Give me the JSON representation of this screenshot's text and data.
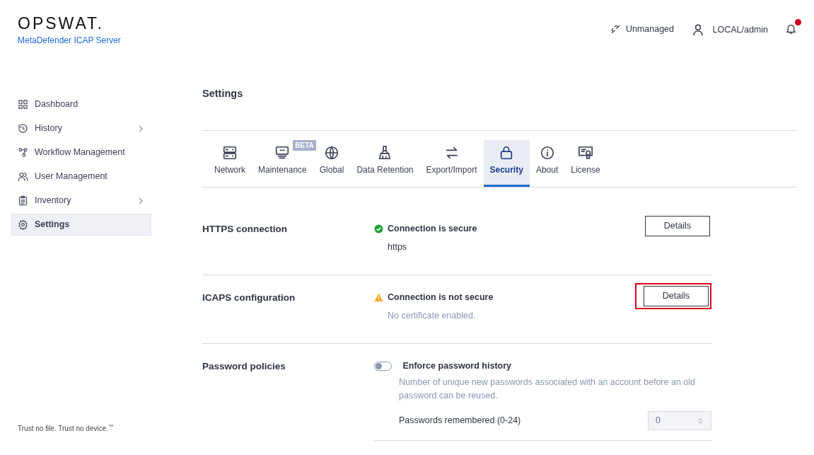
{
  "brand": {
    "logo": "OPSWAT.",
    "product": "MetaDefender ICAP Server"
  },
  "header": {
    "management": "Unmanaged",
    "user": "LOCAL/admin",
    "notification": true
  },
  "sidebar": {
    "items": [
      {
        "label": "Dashboard",
        "selected": false,
        "expandable": false
      },
      {
        "label": "History",
        "selected": false,
        "expandable": true
      },
      {
        "label": "Workflow Management",
        "selected": false,
        "expandable": false
      },
      {
        "label": "User Management",
        "selected": false,
        "expandable": false
      },
      {
        "label": "Inventory",
        "selected": false,
        "expandable": true
      },
      {
        "label": "Settings",
        "selected": true,
        "expandable": false
      }
    ],
    "footer": "Trust no file. Trust no device.$^{™}$"
  },
  "page_title": "Settings",
  "tabs": [
    {
      "label": "Network",
      "selected": false
    },
    {
      "label": "Maintenance",
      "selected": false,
      "badge": "BETA"
    },
    {
      "label": "Global",
      "selected": false
    },
    {
      "label": "Data Retention",
      "selected": false
    },
    {
      "label": "Export/Import",
      "selected": false
    },
    {
      "label": "Security",
      "selected": true
    },
    {
      "label": "About",
      "selected": false
    },
    {
      "label": "License",
      "selected": false
    }
  ],
  "sections": [
    {
      "kind": "status",
      "title": "HTTPS connection",
      "status": {
        "kind": "ok",
        "text": "Connection is secure"
      },
      "detail": "https",
      "detail_muted": false,
      "button": "Details",
      "highlighted": false
    },
    {
      "kind": "status",
      "title": "ICAPS configuration",
      "status": {
        "kind": "warning",
        "text": "Connection is not secure"
      },
      "detail": "No certificate enabled.",
      "detail_muted": true,
      "button": "Details",
      "highlighted": true
    },
    {
      "kind": "toggle",
      "title": "Password policies",
      "toggle": {
        "label": "Enforce password history",
        "on": false
      },
      "description": "Number of unique new passwords associated with an account before an old password can be reused.",
      "field": {
        "label": "Passwords remembered (0-24)",
        "value": "0"
      }
    }
  ]
}
